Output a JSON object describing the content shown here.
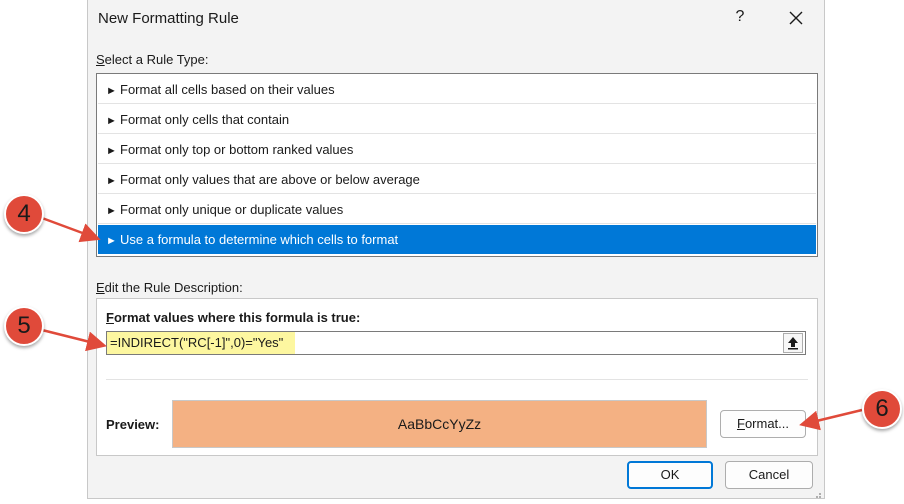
{
  "dialog": {
    "title": "New Formatting Rule",
    "help_label": "?",
    "close_icon": "close-icon"
  },
  "rule_type": {
    "label": "Select a Rule Type:",
    "items": [
      {
        "label": "Format all cells based on their values",
        "selected": false
      },
      {
        "label": "Format only cells that contain",
        "selected": false
      },
      {
        "label": "Format only top or bottom ranked values",
        "selected": false
      },
      {
        "label": "Format only values that are above or below average",
        "selected": false
      },
      {
        "label": "Format only unique or duplicate values",
        "selected": false
      },
      {
        "label": "Use a formula to determine which cells to format",
        "selected": true
      }
    ],
    "arrow_glyph": "►"
  },
  "rule_description": {
    "label": "Edit the Rule Description:",
    "formula_heading": "Format values where this formula is true:",
    "formula_value": "=INDIRECT(\"RC[-1]\",0)=\"Yes\"",
    "preview_label": "Preview:",
    "preview_text": "AaBbCcYyZz",
    "preview_color": "#f4b183",
    "format_button": "Format..."
  },
  "footer": {
    "ok_label": "OK",
    "cancel_label": "Cancel"
  },
  "annotations": [
    {
      "number": "4"
    },
    {
      "number": "5"
    },
    {
      "number": "6"
    }
  ],
  "colors": {
    "selection": "#0078d7",
    "highlight": "#fdf7a0",
    "callout": "#e04a3a"
  }
}
